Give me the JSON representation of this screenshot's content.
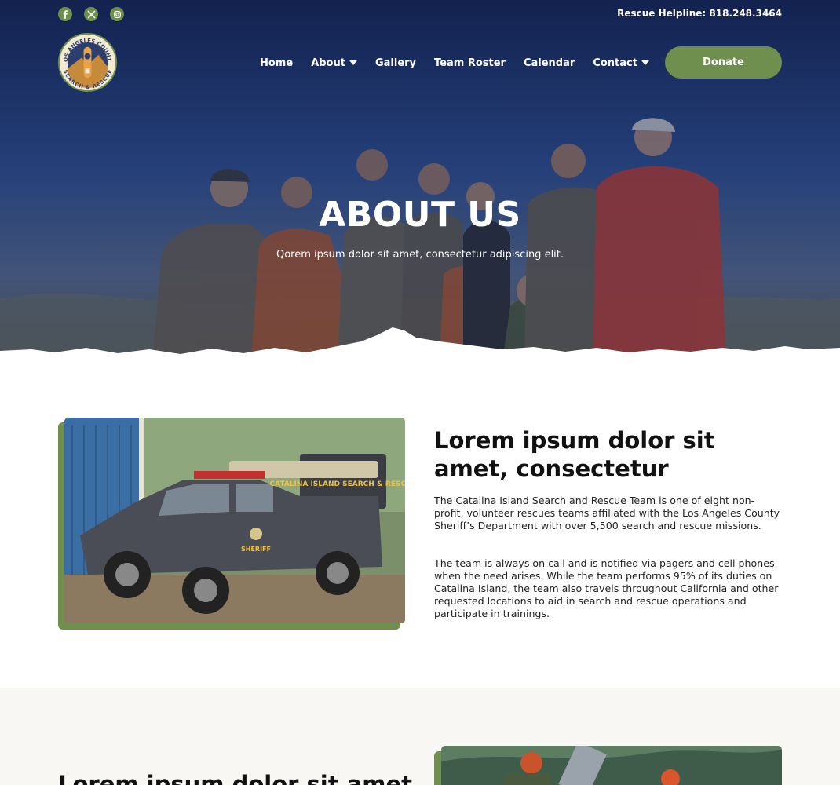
{
  "topbar": {
    "social": [
      {
        "icon": "facebook-icon"
      },
      {
        "icon": "x-twitter-icon"
      },
      {
        "icon": "instagram-icon"
      }
    ],
    "helpline": "Rescue Helpline: 818.248.3464"
  },
  "logo": {
    "top_text": "LOS ANGELES COUNTY",
    "bottom_text": "SEARCH & RESCUE"
  },
  "nav": {
    "items": [
      {
        "label": "Home",
        "dropdown": false
      },
      {
        "label": "About",
        "dropdown": true
      },
      {
        "label": "Gallery",
        "dropdown": false
      },
      {
        "label": "Team Roster",
        "dropdown": false
      },
      {
        "label": "Calendar",
        "dropdown": false
      },
      {
        "label": "Contact",
        "dropdown": true
      }
    ],
    "donate_label": "Donate"
  },
  "hero": {
    "title": "ABOUT US",
    "subtitle": "Qorem ipsum dolor sit amet, consectetur adipiscing elit."
  },
  "section1": {
    "heading": "Lorem ipsum dolor sit amet, consectetur",
    "paragraph1": "The Catalina Island Search and Rescue Team is one of eight non-profit, volunteer rescues teams affiliated with the Los Angeles County Sheriff’s Department with over 5,500 search and rescue missions.",
    "paragraph2": "The team is always on call and is notified via pagers and cell phones when the need arises. While the team performs 95% of its duties on Catalina Island, the team also travels throughout California and other requested locations to aid in search and rescue operations and participate in trainings.",
    "image_text": {
      "truck_sign": "CATALINA ISLAND SEARCH & RESCUE",
      "door_text": "SHERIFF"
    }
  },
  "section2": {
    "heading": "Lorem ipsum dolor sit amet"
  },
  "colors": {
    "accent": "#6e8f4e",
    "hero_overlay": "#1b2c66",
    "section_bg": "#f8f7f4"
  }
}
